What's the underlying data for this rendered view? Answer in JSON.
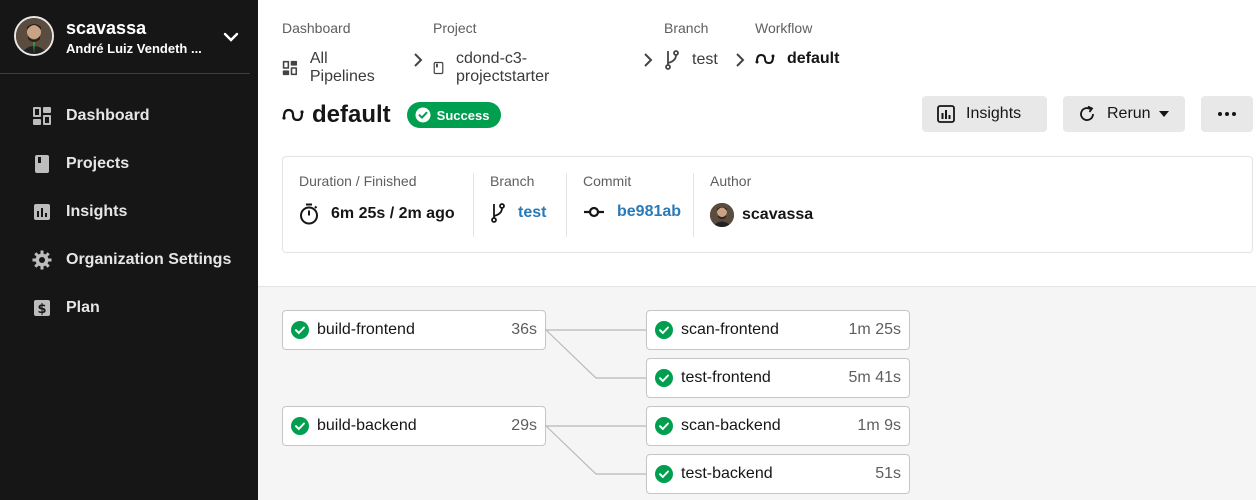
{
  "account": {
    "username": "scavassa",
    "full_name": "André Luiz Vendeth ..."
  },
  "sidebar": {
    "items": [
      {
        "label": "Dashboard",
        "icon": "dashboard-icon"
      },
      {
        "label": "Projects",
        "icon": "projects-icon"
      },
      {
        "label": "Insights",
        "icon": "insights-icon"
      },
      {
        "label": "Organization Settings",
        "icon": "gear-icon"
      },
      {
        "label": "Plan",
        "icon": "dollar-icon"
      }
    ]
  },
  "breadcrumbs": [
    {
      "label": "Dashboard",
      "value": "All Pipelines",
      "icon": "pipelines-icon"
    },
    {
      "label": "Project",
      "value": "cdond-c3-projectstarter",
      "icon": "project-icon"
    },
    {
      "label": "Branch",
      "value": "test",
      "icon": "branch-icon"
    },
    {
      "label": "Workflow",
      "value": "default",
      "icon": "workflow-icon"
    }
  ],
  "workflow": {
    "name": "default",
    "status": "Success",
    "status_color": "#009e4f"
  },
  "actions": {
    "insights_label": "Insights",
    "rerun_label": "Rerun"
  },
  "meta": {
    "duration_label": "Duration / Finished",
    "duration_value": "6m 25s / 2m ago",
    "branch_label": "Branch",
    "branch_value": "test",
    "commit_label": "Commit",
    "commit_value": "be981ab",
    "author_label": "Author",
    "author_value": "scavassa",
    "link_color": "#2a7ab8"
  },
  "jobs": [
    {
      "name": "build-frontend",
      "duration": "36s",
      "status": "success"
    },
    {
      "name": "scan-frontend",
      "duration": "1m 25s",
      "status": "success"
    },
    {
      "name": "test-frontend",
      "duration": "5m 41s",
      "status": "success"
    },
    {
      "name": "build-backend",
      "duration": "29s",
      "status": "success"
    },
    {
      "name": "scan-backend",
      "duration": "1m 9s",
      "status": "success"
    },
    {
      "name": "test-backend",
      "duration": "51s",
      "status": "success"
    }
  ]
}
